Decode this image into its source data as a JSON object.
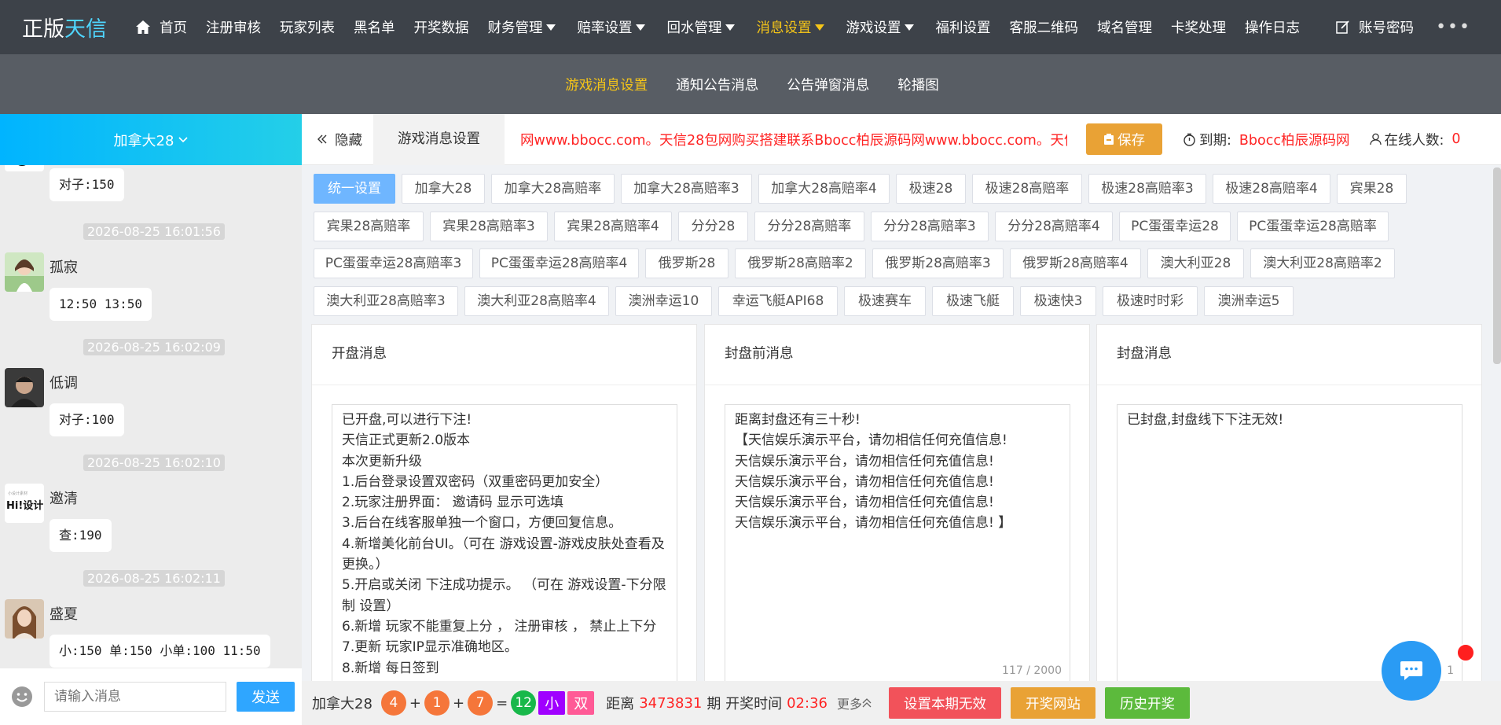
{
  "brand": {
    "part1": "正版",
    "part2": "天信"
  },
  "nav": [
    {
      "label": "首页",
      "icon": "home-icon"
    },
    {
      "label": "注册审核"
    },
    {
      "label": "玩家列表"
    },
    {
      "label": "黑名单"
    },
    {
      "label": "开奖数据"
    },
    {
      "label": "财务管理",
      "dropdown": true
    },
    {
      "label": "赔率设置",
      "dropdown": true
    },
    {
      "label": "回水管理",
      "dropdown": true
    },
    {
      "label": "消息设置",
      "dropdown": true,
      "active": true
    },
    {
      "label": "游戏设置",
      "dropdown": true
    },
    {
      "label": "福利设置"
    },
    {
      "label": "客服二维码"
    },
    {
      "label": "域名管理"
    },
    {
      "label": "卡奖处理"
    },
    {
      "label": "操作日志"
    },
    {
      "label": "账号密码",
      "icon": "edit-icon"
    }
  ],
  "nav_more": "•••",
  "subnav": [
    {
      "label": "游戏消息设置",
      "active": true
    },
    {
      "label": "通知公告消息"
    },
    {
      "label": "公告弹窗消息"
    },
    {
      "label": "轮播图"
    }
  ],
  "lottery_select": "加拿大28",
  "chat": {
    "partial_bubble": "对子:150",
    "messages": [
      {
        "time": "2026-08-25 16:01:56",
        "name": "孤寂",
        "text": "12:50 13:50"
      },
      {
        "time": "2026-08-25 16:02:09",
        "name": "低调",
        "text": "对子:100"
      },
      {
        "time": "2026-08-25 16:02:10",
        "name": "邀清",
        "text": "查:190",
        "avatar_text": "Hi!设计"
      },
      {
        "time": "2026-08-25 16:02:11",
        "name": "盛夏",
        "text": "小:150 单:150 小单:100 11:50"
      }
    ],
    "input_placeholder": "请输入消息",
    "send_label": "发送"
  },
  "header": {
    "hide_label": "隐藏",
    "current_tab": "游戏消息设置",
    "marquee": "网www.bbocc.com。天信28包网购买搭建联系Bbocc柏辰源码网www.bbocc.com。天信28包网",
    "save_label": "保存",
    "expire_label": "到期:",
    "expire_value": "Bbocc柏辰源码网",
    "online_label": "在线人数:",
    "online_value": "0"
  },
  "game_tags": [
    [
      "统一设置",
      "加拿大28",
      "加拿大28高赔率",
      "加拿大28高赔率3",
      "加拿大28高赔率4",
      "极速28",
      "极速28高赔率",
      "极速28高赔率3",
      "极速28高赔率4",
      "宾果28"
    ],
    [
      "宾果28高赔率",
      "宾果28高赔率3",
      "宾果28高赔率4",
      "分分28",
      "分分28高赔率",
      "分分28高赔率3",
      "分分28高赔率4",
      "PC蛋蛋幸运28",
      "PC蛋蛋幸运28高赔率"
    ],
    [
      "PC蛋蛋幸运28高赔率3",
      "PC蛋蛋幸运28高赔率4",
      "俄罗斯28",
      "俄罗斯28高赔率2",
      "俄罗斯28高赔率3",
      "俄罗斯28高赔率4",
      "澳大利亚28",
      "澳大利亚28高赔率2"
    ],
    [
      "澳大利亚28高赔率3",
      "澳大利亚28高赔率4",
      "澳洲幸运10",
      "幸运飞艇API68",
      "极速赛车",
      "极速飞艇",
      "极速快3",
      "极速时时彩",
      "澳洲幸运5"
    ]
  ],
  "cards": [
    {
      "title": "开盘消息",
      "text": "已开盘,可以进行下注!\n天信正式更新2.0版本\n本次更新升级\n1.后台登录设置双密码（双重密码更加安全）\n2.玩家注册界面： 邀请码 显示可选填\n3.后台在线客服单独一个窗口，方便回复信息。\n4.新增美化前台UI。（可在 游戏设置-游戏皮肤处查看及更换。）\n5.开启或关闭 下注成功提示。 （可在 游戏设置-下分限制 设置）\n6.新增 玩家不能重复上分 ， 注册审核 ， 禁止上下分\n7.更新 玩家IP显示准确地区。\n8.新增 每日签到",
      "counter": ""
    },
    {
      "title": "封盘前消息",
      "text": "距离封盘还有三十秒!\n【天信娱乐演示平台，请勿相信任何充值信息!\n天信娱乐演示平台，请勿相信任何充值信息!\n天信娱乐演示平台，请勿相信任何充值信息!\n天信娱乐演示平台，请勿相信任何充值信息!\n天信娱乐演示平台，请勿相信任何充值信息! 】",
      "counter": "117 / 2000"
    },
    {
      "title": "封盘消息",
      "text": "已封盘,封盘线下下注无效!",
      "counter": "1"
    }
  ],
  "bottom": {
    "game": "加拿大28",
    "balls": [
      "4",
      "1",
      "7"
    ],
    "plus": "+",
    "equals": "=",
    "sum": "12",
    "size": "小",
    "parity": "双",
    "dist_label": "距离",
    "period": "3473831",
    "period_suffix": "期 开奖时间",
    "countdown": "02:36",
    "more_label": "更多",
    "btn_invalid": "设置本期无效",
    "btn_site": "开奖网站",
    "btn_history": "历史开奖"
  },
  "colors": {
    "accent_yellow": "#f5c518",
    "ball_orange": "#f5763a",
    "ball_green": "#18b84a",
    "tag_purple": "#a000ff",
    "tag_pink": "#ff5a96",
    "btn_red": "#f2525a",
    "btn_orange": "#e9a235",
    "btn_green": "#5cba3c",
    "alert_red": "#ff2424"
  }
}
